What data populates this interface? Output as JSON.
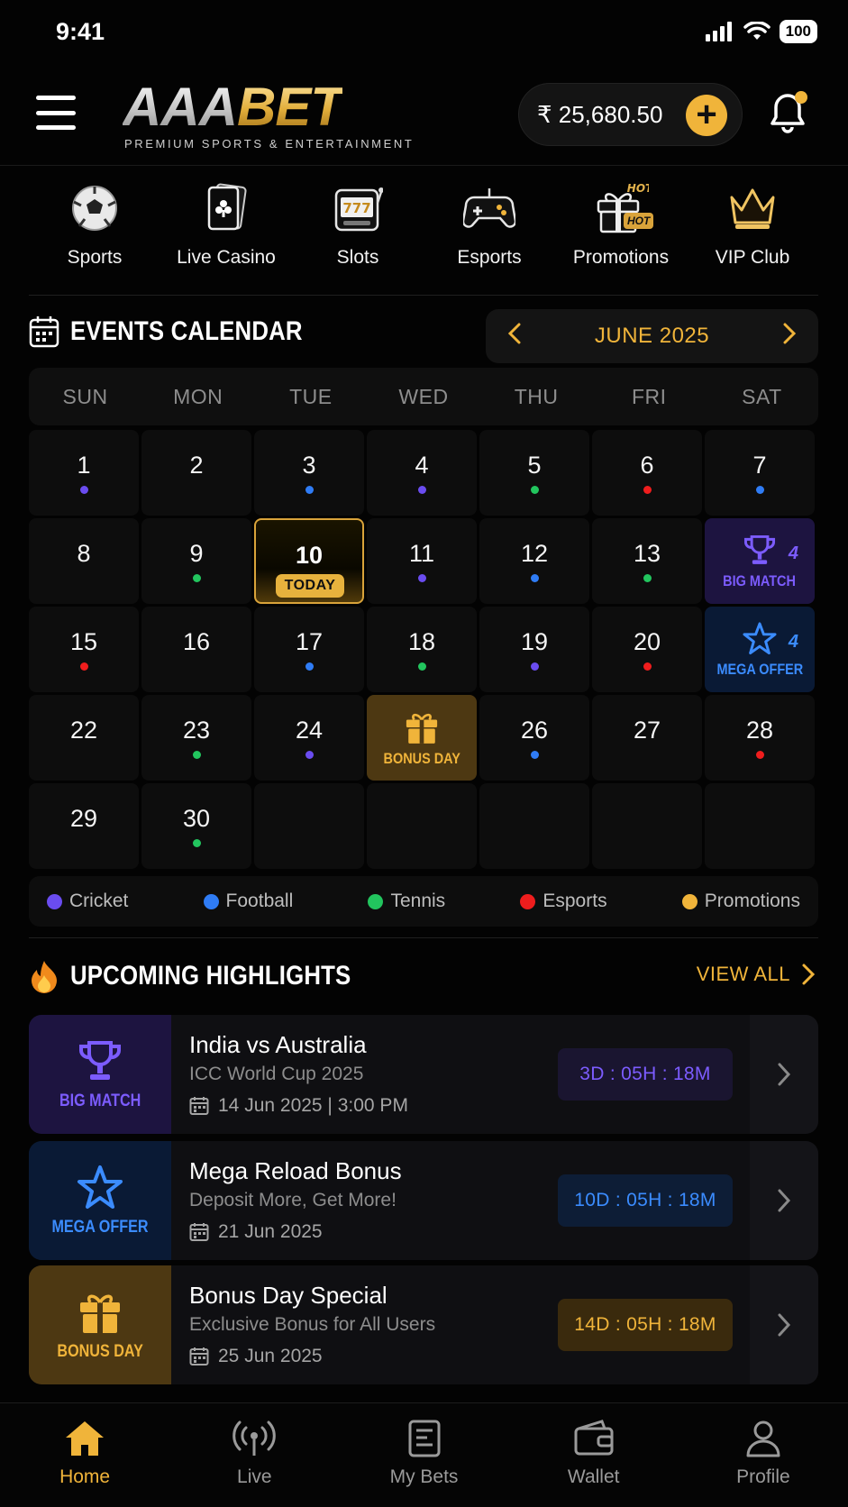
{
  "status": {
    "time": "9:41",
    "battery": "100"
  },
  "header": {
    "logo_part1": "AAA",
    "logo_part2": "BET",
    "tagline": "PREMIUM SPORTS & ENTERTAINMENT",
    "balance": "₹ 25,680.50",
    "add_label": "+"
  },
  "quicknav": [
    {
      "label": "Sports",
      "icon": "soccer-ball-icon"
    },
    {
      "label": "Live Casino",
      "icon": "playing-card-icon"
    },
    {
      "label": "Slots",
      "icon": "slot-machine-icon"
    },
    {
      "label": "Esports",
      "icon": "gamepad-icon"
    },
    {
      "label": "Promotions",
      "icon": "gift-icon",
      "badge": "HOT",
      "badge2": "HOT"
    },
    {
      "label": "VIP Club",
      "icon": "crown-icon"
    }
  ],
  "calendar": {
    "title": "EVENTS CALENDAR",
    "month": "JUNE 2025",
    "weekdays": [
      "SUN",
      "MON",
      "TUE",
      "WED",
      "THU",
      "FRI",
      "SAT"
    ],
    "today_label": "TODAY",
    "cells": [
      {
        "day": "1",
        "dot": "cricket"
      },
      {
        "day": "2"
      },
      {
        "day": "3",
        "dot": "football"
      },
      {
        "day": "4",
        "dot": "cricket"
      },
      {
        "day": "5",
        "dot": "tennis"
      },
      {
        "day": "6",
        "dot": "esports"
      },
      {
        "day": "7",
        "dot": "football"
      },
      {
        "day": "8"
      },
      {
        "day": "9",
        "dot": "tennis"
      },
      {
        "day": "10",
        "today": true
      },
      {
        "day": "11",
        "dot": "cricket"
      },
      {
        "day": "12",
        "dot": "football"
      },
      {
        "day": "13",
        "dot": "tennis"
      },
      {
        "special": "BIG MATCH",
        "kind": "purple",
        "corner": "4"
      },
      {
        "day": "15",
        "dot": "esports"
      },
      {
        "day": "16"
      },
      {
        "day": "17",
        "dot": "football"
      },
      {
        "day": "18",
        "dot": "tennis"
      },
      {
        "day": "19",
        "dot": "cricket"
      },
      {
        "day": "20",
        "dot": "esports"
      },
      {
        "special": "MEGA OFFER",
        "kind": "blue",
        "corner": "4"
      },
      {
        "day": "22"
      },
      {
        "day": "23",
        "dot": "tennis"
      },
      {
        "day": "24",
        "dot": "cricket"
      },
      {
        "special": "BONUS DAY",
        "kind": "gold"
      },
      {
        "day": "26",
        "dot": "football"
      },
      {
        "day": "27"
      },
      {
        "day": "28",
        "dot": "esports"
      },
      {
        "day": "29"
      },
      {
        "day": "30",
        "dot": "tennis"
      },
      {},
      {},
      {},
      {},
      {}
    ]
  },
  "legend": [
    {
      "label": "Cricket",
      "color": "#6a4cf0"
    },
    {
      "label": "Football",
      "color": "#2f7cf5"
    },
    {
      "label": "Tennis",
      "color": "#22c55e"
    },
    {
      "label": "Esports",
      "color": "#ef1d1d"
    },
    {
      "label": "Promotions",
      "color": "#f0b43a"
    }
  ],
  "highlights": {
    "title": "UPCOMING HIGHLIGHTS",
    "view_all": "VIEW ALL",
    "items": [
      {
        "tag": "BIG MATCH",
        "kind": "purple",
        "title": "India vs Australia",
        "subtitle": "ICC World Cup 2025",
        "date": "14 Jun 2025 | 3:00 PM",
        "countdown": "3D : 05H : 18M"
      },
      {
        "tag": "MEGA OFFER",
        "kind": "blue",
        "title": "Mega Reload Bonus",
        "subtitle": "Deposit More, Get More!",
        "date": "21 Jun 2025",
        "countdown": "10D : 05H : 18M"
      },
      {
        "tag": "BONUS DAY",
        "kind": "gold",
        "title": "Bonus Day Special",
        "subtitle": "Exclusive Bonus for All Users",
        "date": "25 Jun 2025",
        "countdown": "14D : 05H : 18M"
      }
    ]
  },
  "tabs": [
    {
      "label": "Home",
      "icon": "home-icon",
      "active": true
    },
    {
      "label": "Live",
      "icon": "live-broadcast-icon"
    },
    {
      "label": "My Bets",
      "icon": "bet-slip-icon"
    },
    {
      "label": "Wallet",
      "icon": "wallet-icon"
    },
    {
      "label": "Profile",
      "icon": "profile-icon"
    }
  ],
  "colors": {
    "accent": "#f0b43a",
    "cricket": "#6a4cf0",
    "football": "#2f7cf5",
    "tennis": "#22c55e",
    "esports": "#ef1d1d",
    "purple": "#7c5cff",
    "blue": "#3b8cff",
    "gold": "#f0b43a"
  }
}
